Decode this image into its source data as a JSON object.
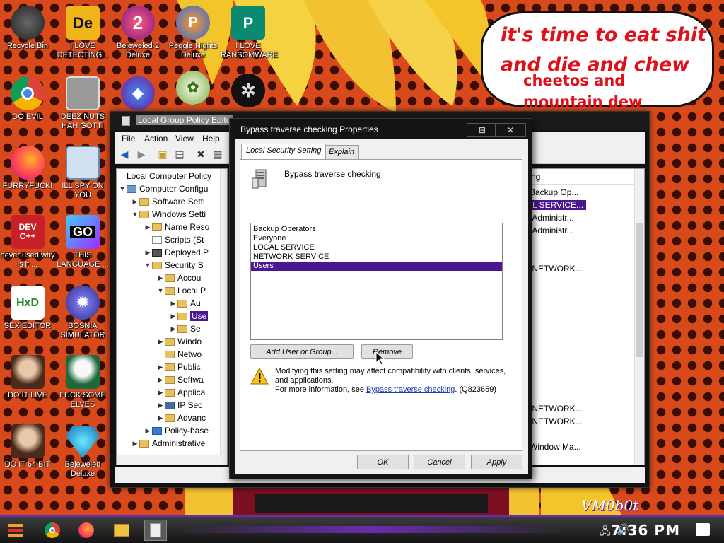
{
  "desktop": {
    "icons": [
      {
        "label": "Recycle Bin"
      },
      {
        "label": "I LOVE DETECTING..."
      },
      {
        "label": "Bejeweled 2 Deluxe"
      },
      {
        "label": "Peggle Nights Deluxe"
      },
      {
        "label": "I LOVE RANSOMWARE"
      },
      {
        "label": "DO EVIL"
      },
      {
        "label": "DEEZ NUTS HAH GOTTI"
      },
      {
        "label": "FURRYFUCK!"
      },
      {
        "label": "ILL SPY ON YOU"
      },
      {
        "label": "never used why is it ..."
      },
      {
        "label": "THIS LANGUAGE ..."
      },
      {
        "label": "SEX EDITOR"
      },
      {
        "label": "BOSNIA SIMULATOR"
      },
      {
        "label": "DO IT LIVE"
      },
      {
        "label": "FUCK SOME ELVES"
      },
      {
        "label": "DO IT 64 BIT"
      },
      {
        "label": "Bejeweled Deluxe"
      }
    ],
    "glyphs": {
      "devcpp": "DEV C++",
      "goland": "GO",
      "hxd": "HxD",
      "i_love_detecting": "De"
    }
  },
  "bubble": {
    "line1": "it's time to eat shit",
    "line2": "and die and chew",
    "line3": "cheetos and",
    "line4": "mountain dew"
  },
  "gpo_window": {
    "title": "Local Group Policy Edito",
    "menu": [
      "File",
      "Action",
      "View",
      "Help"
    ],
    "tree": [
      {
        "label": "Local Computer Policy"
      },
      {
        "label": "Computer Configu"
      },
      {
        "label": "Software Setti"
      },
      {
        "label": "Windows Setti"
      },
      {
        "label": "Name Reso"
      },
      {
        "label": "Scripts (St"
      },
      {
        "label": "Deployed P"
      },
      {
        "label": "Security S"
      },
      {
        "label": "Accou"
      },
      {
        "label": "Local P"
      },
      {
        "label": "Au"
      },
      {
        "label": "Use"
      },
      {
        "label": "Se"
      },
      {
        "label": "Windo"
      },
      {
        "label": "Netwo"
      },
      {
        "label": "Public"
      },
      {
        "label": "Softwa"
      },
      {
        "label": "Applica"
      },
      {
        "label": "IP Sec"
      },
      {
        "label": "Advanc"
      },
      {
        "label": "Policy-base"
      },
      {
        "label": "Administrative"
      }
    ],
    "list_header": "ng",
    "list_values": [
      "Backup Op...",
      "L SERVICE...",
      ",Administr...",
      ",Administr...",
      ",NETWORK...",
      ",NETWORK...",
      ",NETWORK...",
      "Window Ma..."
    ]
  },
  "dialog": {
    "title": "Bypass traverse checking Properties",
    "minimize_symbol": "⊟",
    "close_symbol": "✕",
    "tabs": [
      {
        "label": "Local Security Setting",
        "active": true
      },
      {
        "label": "Explain",
        "active": false
      }
    ],
    "policy_name": "Bypass traverse checking",
    "principals": [
      "Backup Operators",
      "Everyone",
      "LOCAL SERVICE",
      "NETWORK SERVICE",
      "Users"
    ],
    "selected_principal": "Users",
    "add_button": "Add User or Group...",
    "remove_button": "Remove",
    "warning_line1": "Modifying this setting may affect compatibility with clients, services,",
    "warning_line2": "and applications.",
    "warning_more_prefix": "For more information, see ",
    "warning_link": "Bypass traverse checking",
    "warning_suffix": ". (Q823659)",
    "ok_button": "OK",
    "cancel_button": "Cancel",
    "apply_button": "Apply"
  },
  "taskbar": {
    "clock": "7:36 PM",
    "watermark": "VM0b0t"
  },
  "colors": {
    "selection": "#4c1591",
    "taskbar_accent": "#6a2cb0"
  }
}
